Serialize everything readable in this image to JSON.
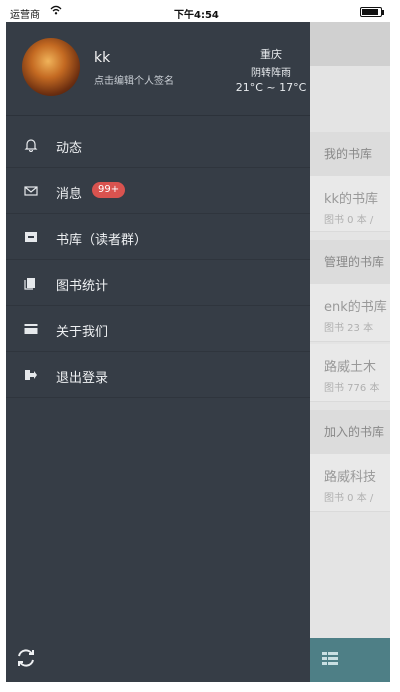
{
  "status_bar": {
    "carrier": "运营商",
    "time": "下午4:54",
    "battery_level": 0.9
  },
  "profile": {
    "username": "kk",
    "signature": "点击编辑个人签名"
  },
  "weather": {
    "city": "重庆",
    "condition": "阴转阵雨",
    "temperature": "21°C ~ 17°C"
  },
  "menu": [
    {
      "label": "动态",
      "icon": "bell-icon"
    },
    {
      "label": "消息",
      "icon": "envelope-icon",
      "badge": "99+"
    },
    {
      "label": "书库（读者群）",
      "icon": "inbox-icon"
    },
    {
      "label": "图书统计",
      "icon": "book-icon"
    },
    {
      "label": "关于我们",
      "icon": "card-icon"
    },
    {
      "label": "退出登录",
      "icon": "logout-icon"
    }
  ],
  "background_page": {
    "sections": [
      "我的书库",
      "管理的书库",
      "加入的书库"
    ],
    "cards": [
      {
        "title": "kk的书库",
        "sub": "图书 0 本 /"
      },
      {
        "title": "enk的书库",
        "sub": "图书 23 本"
      },
      {
        "title": "路威土木",
        "sub": "图书 776 本"
      },
      {
        "title": "路威科技",
        "sub": "图书 0 本 /"
      }
    ]
  },
  "colors": {
    "drawer": "#363d46",
    "badge": "#d9534f",
    "bottom_bar": "#4e7f86"
  }
}
